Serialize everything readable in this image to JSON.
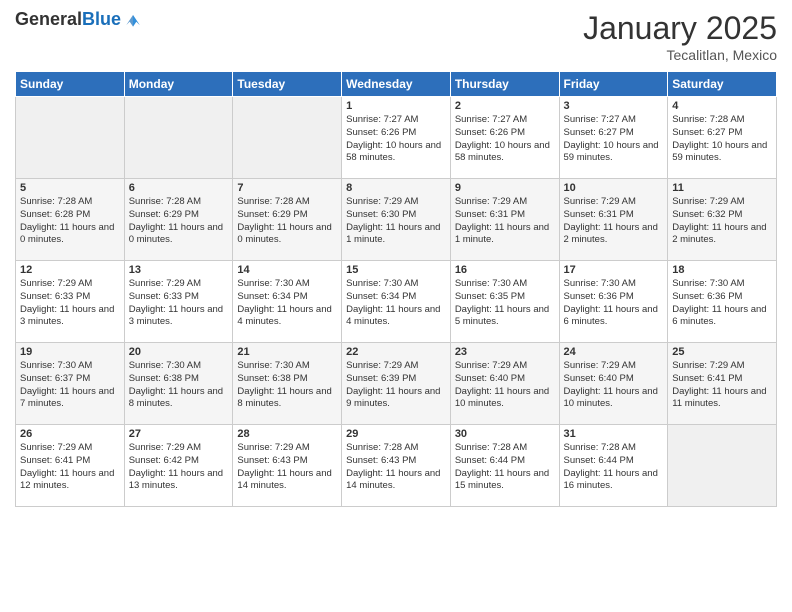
{
  "header": {
    "logo_general": "General",
    "logo_blue": "Blue",
    "month_title": "January 2025",
    "location": "Tecalitlan, Mexico"
  },
  "days_of_week": [
    "Sunday",
    "Monday",
    "Tuesday",
    "Wednesday",
    "Thursday",
    "Friday",
    "Saturday"
  ],
  "weeks": [
    [
      {
        "day": "",
        "info": ""
      },
      {
        "day": "",
        "info": ""
      },
      {
        "day": "",
        "info": ""
      },
      {
        "day": "1",
        "info": "Sunrise: 7:27 AM\nSunset: 6:26 PM\nDaylight: 10 hours and 58 minutes."
      },
      {
        "day": "2",
        "info": "Sunrise: 7:27 AM\nSunset: 6:26 PM\nDaylight: 10 hours and 58 minutes."
      },
      {
        "day": "3",
        "info": "Sunrise: 7:27 AM\nSunset: 6:27 PM\nDaylight: 10 hours and 59 minutes."
      },
      {
        "day": "4",
        "info": "Sunrise: 7:28 AM\nSunset: 6:27 PM\nDaylight: 10 hours and 59 minutes."
      }
    ],
    [
      {
        "day": "5",
        "info": "Sunrise: 7:28 AM\nSunset: 6:28 PM\nDaylight: 11 hours and 0 minutes."
      },
      {
        "day": "6",
        "info": "Sunrise: 7:28 AM\nSunset: 6:29 PM\nDaylight: 11 hours and 0 minutes."
      },
      {
        "day": "7",
        "info": "Sunrise: 7:28 AM\nSunset: 6:29 PM\nDaylight: 11 hours and 0 minutes."
      },
      {
        "day": "8",
        "info": "Sunrise: 7:29 AM\nSunset: 6:30 PM\nDaylight: 11 hours and 1 minute."
      },
      {
        "day": "9",
        "info": "Sunrise: 7:29 AM\nSunset: 6:31 PM\nDaylight: 11 hours and 1 minute."
      },
      {
        "day": "10",
        "info": "Sunrise: 7:29 AM\nSunset: 6:31 PM\nDaylight: 11 hours and 2 minutes."
      },
      {
        "day": "11",
        "info": "Sunrise: 7:29 AM\nSunset: 6:32 PM\nDaylight: 11 hours and 2 minutes."
      }
    ],
    [
      {
        "day": "12",
        "info": "Sunrise: 7:29 AM\nSunset: 6:33 PM\nDaylight: 11 hours and 3 minutes."
      },
      {
        "day": "13",
        "info": "Sunrise: 7:29 AM\nSunset: 6:33 PM\nDaylight: 11 hours and 3 minutes."
      },
      {
        "day": "14",
        "info": "Sunrise: 7:30 AM\nSunset: 6:34 PM\nDaylight: 11 hours and 4 minutes."
      },
      {
        "day": "15",
        "info": "Sunrise: 7:30 AM\nSunset: 6:34 PM\nDaylight: 11 hours and 4 minutes."
      },
      {
        "day": "16",
        "info": "Sunrise: 7:30 AM\nSunset: 6:35 PM\nDaylight: 11 hours and 5 minutes."
      },
      {
        "day": "17",
        "info": "Sunrise: 7:30 AM\nSunset: 6:36 PM\nDaylight: 11 hours and 6 minutes."
      },
      {
        "day": "18",
        "info": "Sunrise: 7:30 AM\nSunset: 6:36 PM\nDaylight: 11 hours and 6 minutes."
      }
    ],
    [
      {
        "day": "19",
        "info": "Sunrise: 7:30 AM\nSunset: 6:37 PM\nDaylight: 11 hours and 7 minutes."
      },
      {
        "day": "20",
        "info": "Sunrise: 7:30 AM\nSunset: 6:38 PM\nDaylight: 11 hours and 8 minutes."
      },
      {
        "day": "21",
        "info": "Sunrise: 7:30 AM\nSunset: 6:38 PM\nDaylight: 11 hours and 8 minutes."
      },
      {
        "day": "22",
        "info": "Sunrise: 7:29 AM\nSunset: 6:39 PM\nDaylight: 11 hours and 9 minutes."
      },
      {
        "day": "23",
        "info": "Sunrise: 7:29 AM\nSunset: 6:40 PM\nDaylight: 11 hours and 10 minutes."
      },
      {
        "day": "24",
        "info": "Sunrise: 7:29 AM\nSunset: 6:40 PM\nDaylight: 11 hours and 10 minutes."
      },
      {
        "day": "25",
        "info": "Sunrise: 7:29 AM\nSunset: 6:41 PM\nDaylight: 11 hours and 11 minutes."
      }
    ],
    [
      {
        "day": "26",
        "info": "Sunrise: 7:29 AM\nSunset: 6:41 PM\nDaylight: 11 hours and 12 minutes."
      },
      {
        "day": "27",
        "info": "Sunrise: 7:29 AM\nSunset: 6:42 PM\nDaylight: 11 hours and 13 minutes."
      },
      {
        "day": "28",
        "info": "Sunrise: 7:29 AM\nSunset: 6:43 PM\nDaylight: 11 hours and 14 minutes."
      },
      {
        "day": "29",
        "info": "Sunrise: 7:28 AM\nSunset: 6:43 PM\nDaylight: 11 hours and 14 minutes."
      },
      {
        "day": "30",
        "info": "Sunrise: 7:28 AM\nSunset: 6:44 PM\nDaylight: 11 hours and 15 minutes."
      },
      {
        "day": "31",
        "info": "Sunrise: 7:28 AM\nSunset: 6:44 PM\nDaylight: 11 hours and 16 minutes."
      },
      {
        "day": "",
        "info": ""
      }
    ]
  ]
}
